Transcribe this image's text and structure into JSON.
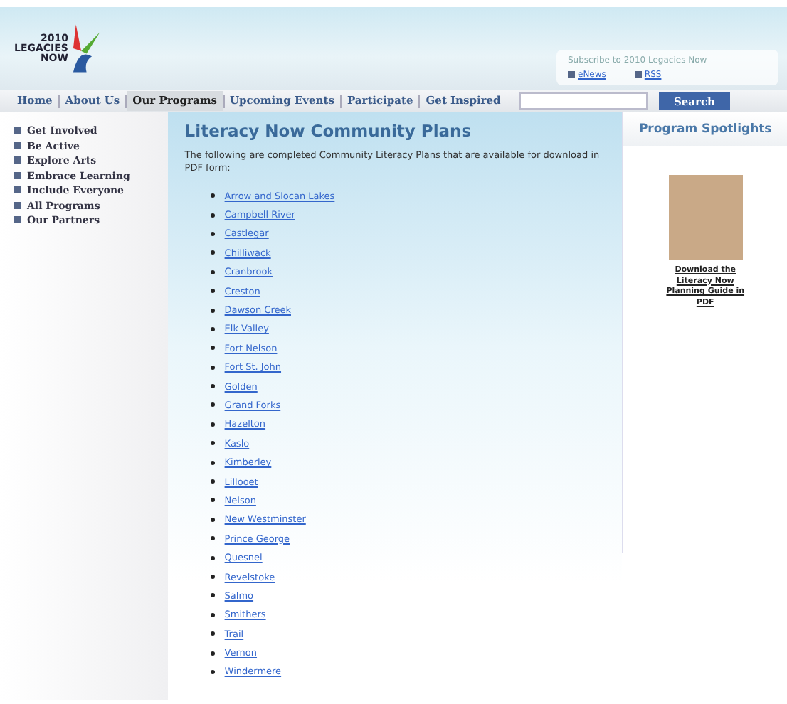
{
  "logo": {
    "lines": [
      "2010",
      "LEGACIES",
      "NOW"
    ]
  },
  "subscribe": {
    "title": "Subscribe to 2010 Legacies Now",
    "links": [
      "eNews",
      "RSS"
    ]
  },
  "nav": [
    {
      "label": "Home",
      "selected": false
    },
    {
      "label": "About Us",
      "selected": false
    },
    {
      "label": "Our Programs",
      "selected": true
    },
    {
      "label": "Upcoming Events",
      "selected": false
    },
    {
      "label": "Participate",
      "selected": false
    },
    {
      "label": "Get Inspired",
      "selected": false
    }
  ],
  "search": {
    "button": "Search"
  },
  "sidebar": {
    "items": [
      "Get Involved",
      "Be Active",
      "Explore Arts",
      "Embrace Learning",
      "Include Everyone",
      "All Programs",
      "Our Partners"
    ]
  },
  "main": {
    "title": "Literacy Now Community Plans",
    "intro": "The following are completed Community Literacy Plans that are available for download in PDF form:",
    "links": [
      "Arrow and Slocan Lakes",
      "Campbell River",
      "Castlegar",
      "Chilliwack",
      "Cranbrook",
      "Creston",
      "Dawson Creek",
      "Elk Valley",
      "Fort Nelson",
      "Fort St. John",
      "Golden",
      "Grand Forks",
      "Hazelton",
      "Kaslo",
      "Kimberley",
      "Lillooet",
      "Nelson",
      "New Westminster",
      "Prince George",
      "Quesnel",
      "Revelstoke",
      "Salmo",
      "Smithers",
      "Trail",
      "Vernon",
      "Windermere"
    ]
  },
  "spotlight": {
    "title": "Program Spotlights",
    "link": "Download the Literacy Now Planning Guide in PDF"
  }
}
